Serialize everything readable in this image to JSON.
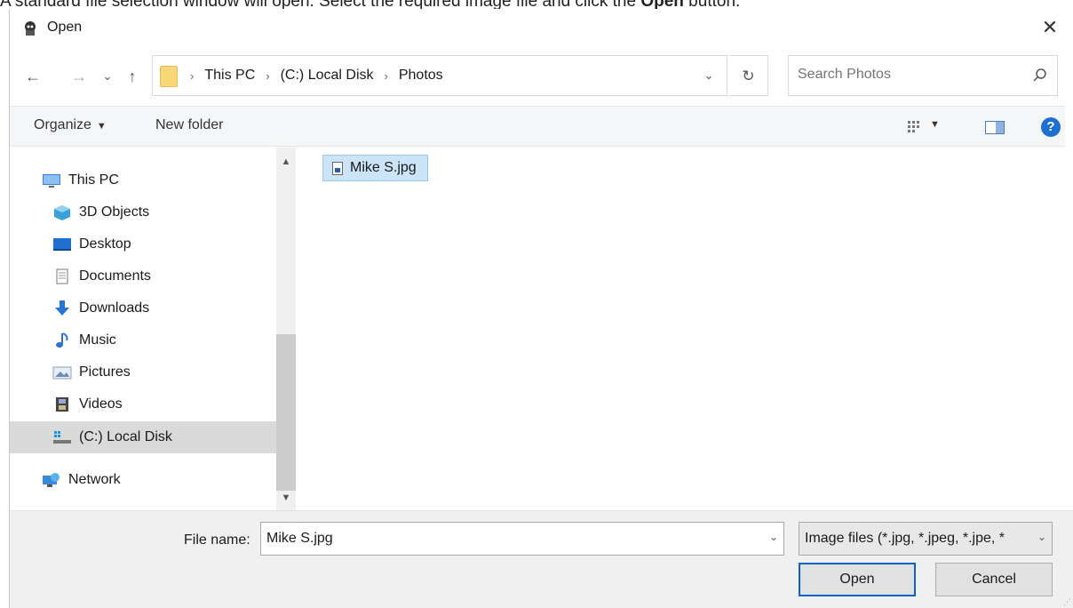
{
  "caption": {
    "prefix": "A standard file selection window will open. Select the required image file and click the ",
    "bold": "Open",
    "suffix": " button."
  },
  "window": {
    "title": "Open",
    "close_glyph": "✕"
  },
  "nav": {
    "back_glyph": "←",
    "forward_glyph": "→",
    "recent_glyph": "⌄",
    "up_glyph": "↑",
    "breadcrumbs": [
      "This PC",
      "(C:) Local Disk",
      "Photos"
    ],
    "crumb_separator": "›",
    "dropdown_glyph": "⌄",
    "refresh_glyph": "↻",
    "search_placeholder": "Search Photos"
  },
  "toolbar": {
    "organize_label": "Organize",
    "new_folder_label": "New folder",
    "help_glyph": "?"
  },
  "sidebar": {
    "items": [
      {
        "label": "This PC",
        "icon": "monitor-icon"
      },
      {
        "label": "3D Objects",
        "icon": "cube-icon"
      },
      {
        "label": "Desktop",
        "icon": "desktop-icon"
      },
      {
        "label": "Documents",
        "icon": "document-icon"
      },
      {
        "label": "Downloads",
        "icon": "download-arrow-icon"
      },
      {
        "label": "Music",
        "icon": "music-note-icon"
      },
      {
        "label": "Pictures",
        "icon": "pictures-icon"
      },
      {
        "label": "Videos",
        "icon": "film-icon"
      },
      {
        "label": "(C:) Local Disk",
        "icon": "drive-icon"
      },
      {
        "label": "Network",
        "icon": "network-icon"
      }
    ],
    "selected": "(C:) Local Disk"
  },
  "files": [
    {
      "name": "Mike S.jpg",
      "selected": true
    }
  ],
  "footer": {
    "file_name_label": "File name:",
    "file_name_value": "Mike S.jpg",
    "filter_value": "Image files (*.jpg, *.jpeg, *.jpe, *",
    "open_label": "Open",
    "cancel_label": "Cancel"
  },
  "colors": {
    "selection_fill": "#cce4f7",
    "selection_border": "#99c9ef",
    "primary_border": "#0a64c8",
    "help_blue": "#1d6fd1"
  }
}
